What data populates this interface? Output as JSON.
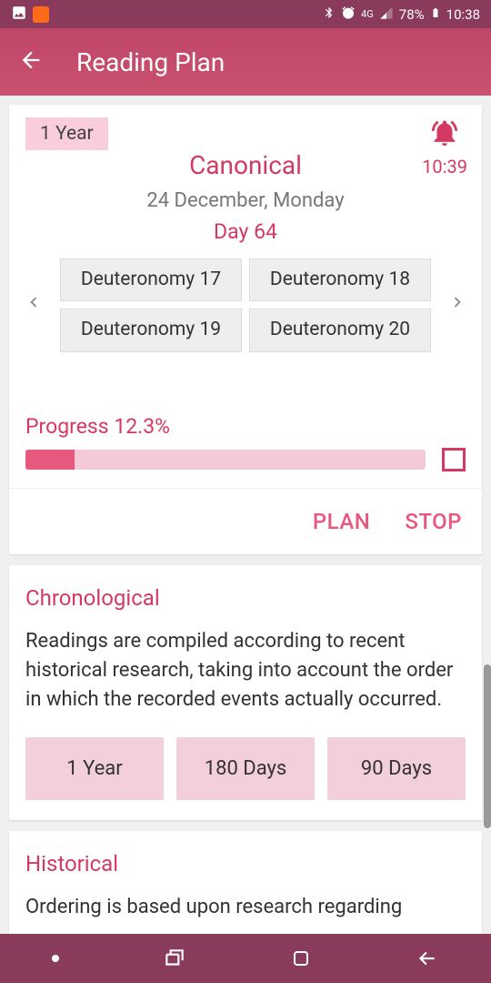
{
  "status": {
    "battery": "78%",
    "time": "10:38",
    "network": "4G"
  },
  "header": {
    "title": "Reading Plan"
  },
  "current_plan": {
    "duration_badge": "1 Year",
    "name": "Canonical",
    "alarm_time": "10:39",
    "date": "24 December, Monday",
    "day": "Day 64",
    "readings": [
      "Deuteronomy 17",
      "Deuteronomy 18",
      "Deuteronomy 19",
      "Deuteronomy 20"
    ],
    "progress_label": "Progress 12.3%",
    "progress_pct": 12.3,
    "actions": {
      "plan": "PLAN",
      "stop": "STOP"
    }
  },
  "plans": [
    {
      "name": "Chronological",
      "description": "Readings are compiled according to recent historical research, taking into account the order in which the recorded events actually occurred.",
      "durations": [
        "1 Year",
        "180 Days",
        "90 Days"
      ]
    },
    {
      "name": "Historical",
      "description": "Ordering is based upon research regarding"
    }
  ]
}
